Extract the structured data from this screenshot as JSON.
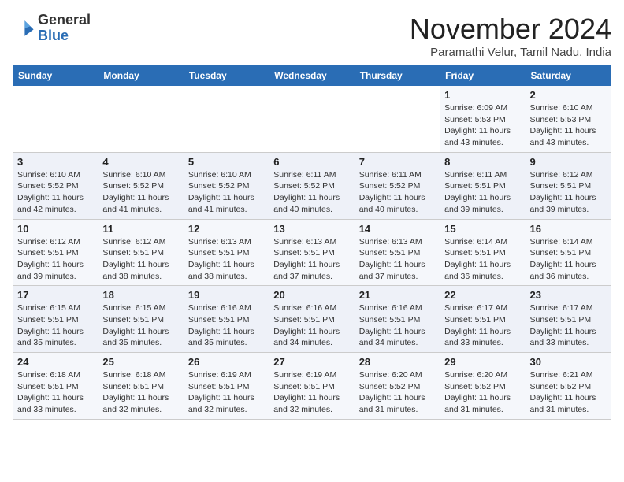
{
  "header": {
    "logo_general": "General",
    "logo_blue": "Blue",
    "month_title": "November 2024",
    "location": "Paramathi Velur, Tamil Nadu, India"
  },
  "days_of_week": [
    "Sunday",
    "Monday",
    "Tuesday",
    "Wednesday",
    "Thursday",
    "Friday",
    "Saturday"
  ],
  "weeks": [
    [
      {
        "day": "",
        "info": ""
      },
      {
        "day": "",
        "info": ""
      },
      {
        "day": "",
        "info": ""
      },
      {
        "day": "",
        "info": ""
      },
      {
        "day": "",
        "info": ""
      },
      {
        "day": "1",
        "info": "Sunrise: 6:09 AM\nSunset: 5:53 PM\nDaylight: 11 hours\nand 43 minutes."
      },
      {
        "day": "2",
        "info": "Sunrise: 6:10 AM\nSunset: 5:53 PM\nDaylight: 11 hours\nand 43 minutes."
      }
    ],
    [
      {
        "day": "3",
        "info": "Sunrise: 6:10 AM\nSunset: 5:52 PM\nDaylight: 11 hours\nand 42 minutes."
      },
      {
        "day": "4",
        "info": "Sunrise: 6:10 AM\nSunset: 5:52 PM\nDaylight: 11 hours\nand 41 minutes."
      },
      {
        "day": "5",
        "info": "Sunrise: 6:10 AM\nSunset: 5:52 PM\nDaylight: 11 hours\nand 41 minutes."
      },
      {
        "day": "6",
        "info": "Sunrise: 6:11 AM\nSunset: 5:52 PM\nDaylight: 11 hours\nand 40 minutes."
      },
      {
        "day": "7",
        "info": "Sunrise: 6:11 AM\nSunset: 5:52 PM\nDaylight: 11 hours\nand 40 minutes."
      },
      {
        "day": "8",
        "info": "Sunrise: 6:11 AM\nSunset: 5:51 PM\nDaylight: 11 hours\nand 39 minutes."
      },
      {
        "day": "9",
        "info": "Sunrise: 6:12 AM\nSunset: 5:51 PM\nDaylight: 11 hours\nand 39 minutes."
      }
    ],
    [
      {
        "day": "10",
        "info": "Sunrise: 6:12 AM\nSunset: 5:51 PM\nDaylight: 11 hours\nand 39 minutes."
      },
      {
        "day": "11",
        "info": "Sunrise: 6:12 AM\nSunset: 5:51 PM\nDaylight: 11 hours\nand 38 minutes."
      },
      {
        "day": "12",
        "info": "Sunrise: 6:13 AM\nSunset: 5:51 PM\nDaylight: 11 hours\nand 38 minutes."
      },
      {
        "day": "13",
        "info": "Sunrise: 6:13 AM\nSunset: 5:51 PM\nDaylight: 11 hours\nand 37 minutes."
      },
      {
        "day": "14",
        "info": "Sunrise: 6:13 AM\nSunset: 5:51 PM\nDaylight: 11 hours\nand 37 minutes."
      },
      {
        "day": "15",
        "info": "Sunrise: 6:14 AM\nSunset: 5:51 PM\nDaylight: 11 hours\nand 36 minutes."
      },
      {
        "day": "16",
        "info": "Sunrise: 6:14 AM\nSunset: 5:51 PM\nDaylight: 11 hours\nand 36 minutes."
      }
    ],
    [
      {
        "day": "17",
        "info": "Sunrise: 6:15 AM\nSunset: 5:51 PM\nDaylight: 11 hours\nand 35 minutes."
      },
      {
        "day": "18",
        "info": "Sunrise: 6:15 AM\nSunset: 5:51 PM\nDaylight: 11 hours\nand 35 minutes."
      },
      {
        "day": "19",
        "info": "Sunrise: 6:16 AM\nSunset: 5:51 PM\nDaylight: 11 hours\nand 35 minutes."
      },
      {
        "day": "20",
        "info": "Sunrise: 6:16 AM\nSunset: 5:51 PM\nDaylight: 11 hours\nand 34 minutes."
      },
      {
        "day": "21",
        "info": "Sunrise: 6:16 AM\nSunset: 5:51 PM\nDaylight: 11 hours\nand 34 minutes."
      },
      {
        "day": "22",
        "info": "Sunrise: 6:17 AM\nSunset: 5:51 PM\nDaylight: 11 hours\nand 33 minutes."
      },
      {
        "day": "23",
        "info": "Sunrise: 6:17 AM\nSunset: 5:51 PM\nDaylight: 11 hours\nand 33 minutes."
      }
    ],
    [
      {
        "day": "24",
        "info": "Sunrise: 6:18 AM\nSunset: 5:51 PM\nDaylight: 11 hours\nand 33 minutes."
      },
      {
        "day": "25",
        "info": "Sunrise: 6:18 AM\nSunset: 5:51 PM\nDaylight: 11 hours\nand 32 minutes."
      },
      {
        "day": "26",
        "info": "Sunrise: 6:19 AM\nSunset: 5:51 PM\nDaylight: 11 hours\nand 32 minutes."
      },
      {
        "day": "27",
        "info": "Sunrise: 6:19 AM\nSunset: 5:51 PM\nDaylight: 11 hours\nand 32 minutes."
      },
      {
        "day": "28",
        "info": "Sunrise: 6:20 AM\nSunset: 5:52 PM\nDaylight: 11 hours\nand 31 minutes."
      },
      {
        "day": "29",
        "info": "Sunrise: 6:20 AM\nSunset: 5:52 PM\nDaylight: 11 hours\nand 31 minutes."
      },
      {
        "day": "30",
        "info": "Sunrise: 6:21 AM\nSunset: 5:52 PM\nDaylight: 11 hours\nand 31 minutes."
      }
    ]
  ]
}
